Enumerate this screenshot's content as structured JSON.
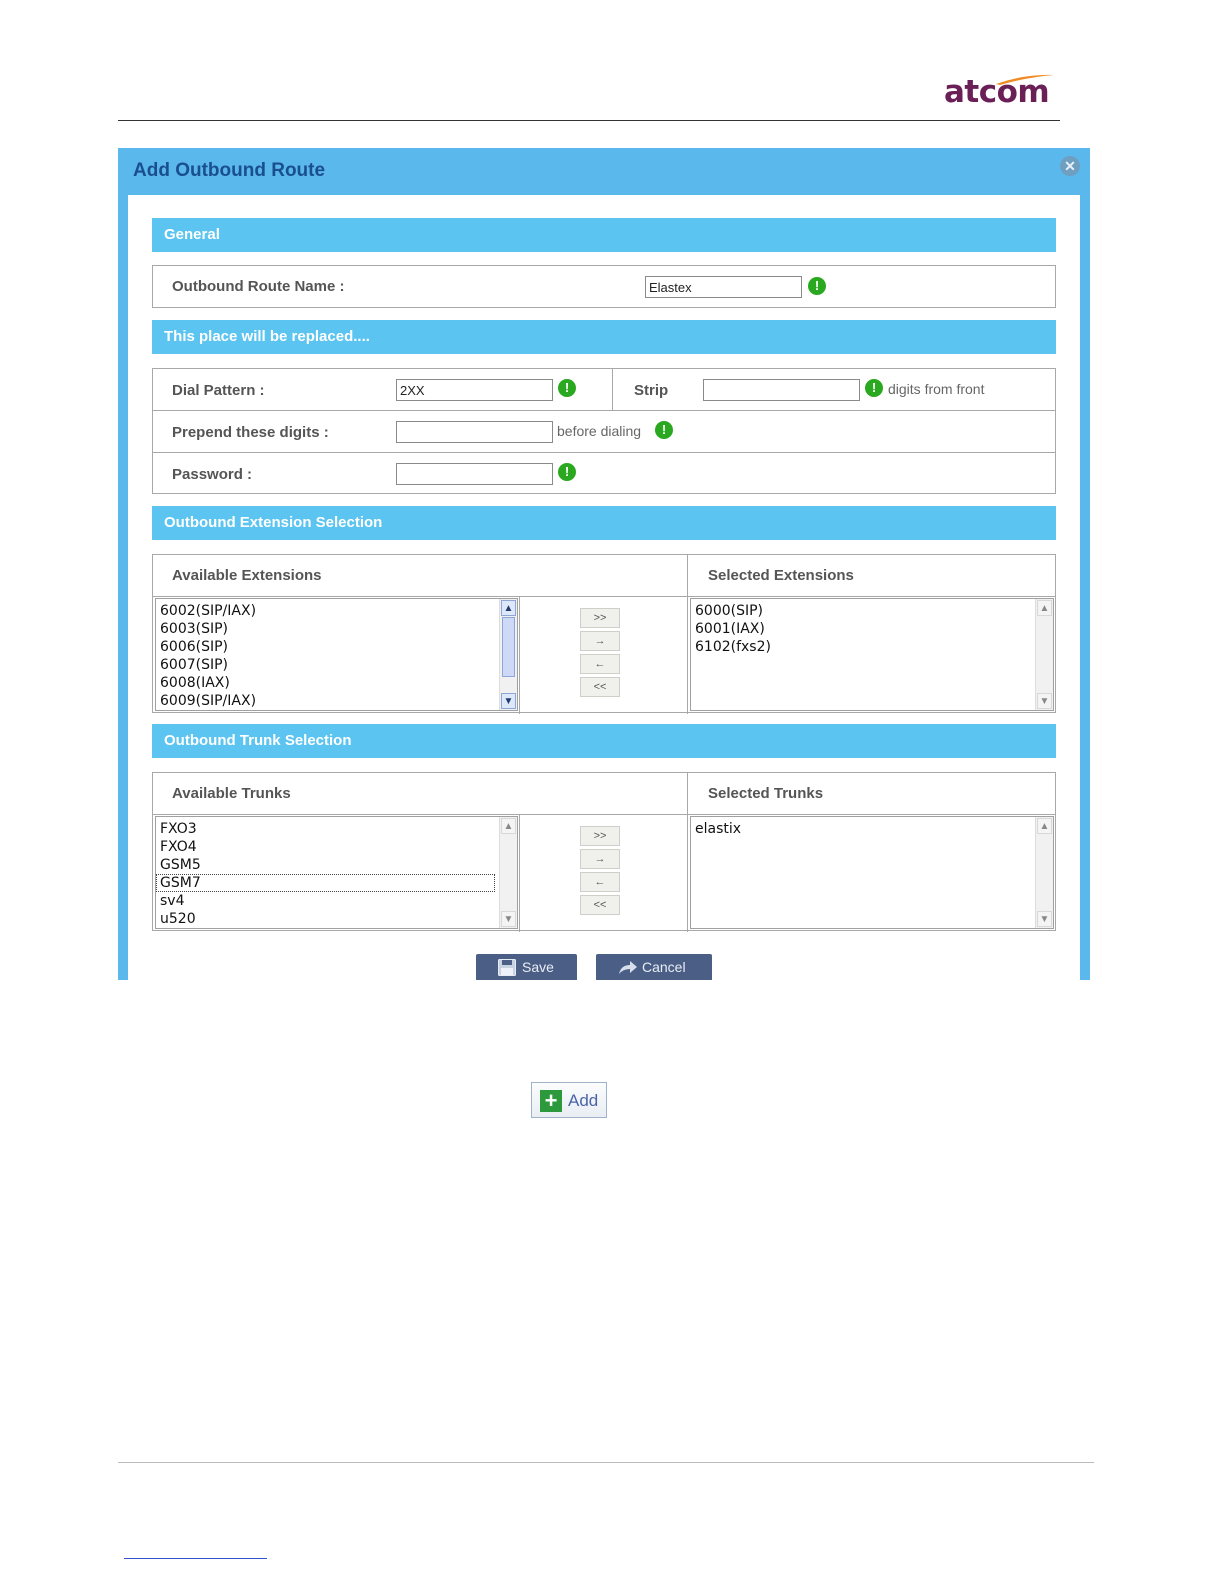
{
  "header": {
    "logo_text": "atcom"
  },
  "dialog": {
    "title": "Add Outbound Route",
    "sections": {
      "general": "General",
      "placeholder": "This place will be replaced....",
      "extensions": "Outbound Extension Selection",
      "trunks": "Outbound Trunk Selection"
    },
    "general": {
      "route_name_label": "Outbound Route Name :",
      "route_name_value": "Elastex"
    },
    "dial": {
      "dial_pattern_label": "Dial Pattern :",
      "dial_pattern_value": "2XX",
      "strip_label": "Strip",
      "strip_value": "",
      "strip_suffix": "digits from front",
      "prepend_label": "Prepend these digits :",
      "prepend_value": "",
      "prepend_suffix": "before dialing",
      "password_label": "Password :",
      "password_value": ""
    },
    "extensions": {
      "available_header": "Available Extensions",
      "selected_header": "Selected Extensions",
      "available": [
        "6002(SIP/IAX)",
        "6003(SIP)",
        "6006(SIP)",
        "6007(SIP)",
        "6008(IAX)",
        "6009(SIP/IAX)"
      ],
      "selected": [
        "6000(SIP)",
        "6001(IAX)",
        "6102(fxs2)"
      ]
    },
    "trunks": {
      "available_header": "Available Trunks",
      "selected_header": "Selected Trunks",
      "available": [
        "FXO3",
        "FXO4",
        "GSM5",
        "GSM7",
        "sv4",
        "u520"
      ],
      "selected": [
        "elastix"
      ]
    },
    "move_buttons": {
      "add_all": ">>",
      "add_one": "→",
      "remove_one": "←",
      "remove_all": "<<"
    },
    "buttons": {
      "save": "Save",
      "cancel": "Cancel"
    },
    "warn_glyph": "!"
  },
  "add_button": {
    "label": "Add"
  },
  "colors": {
    "section_bar": "#5bc4f0",
    "dialog_frame": "#5bb8ec",
    "title": "#1a4f8f",
    "warning": "#2aa820",
    "brand": "#6a1f57",
    "swoosh": "#f08a24"
  }
}
